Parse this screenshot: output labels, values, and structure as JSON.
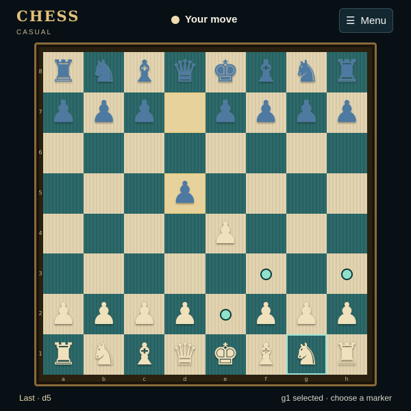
{
  "brand": {
    "title": "CHESS",
    "subtitle": "CASUAL"
  },
  "turn": {
    "text": "Your move"
  },
  "menu": {
    "label": "Menu"
  },
  "board": {
    "ranks": [
      "8",
      "7",
      "6",
      "5",
      "4",
      "3",
      "2",
      "1"
    ],
    "files": [
      "a",
      "b",
      "c",
      "d",
      "e",
      "f",
      "g",
      "h"
    ],
    "position": [
      [
        "br",
        "bn",
        "bb",
        "bq",
        "bk",
        "bb",
        "bn",
        "br"
      ],
      [
        "bp",
        "bp",
        "bp",
        "",
        "bp",
        "bp",
        "bp",
        "bp"
      ],
      [
        "",
        "",
        "",
        "",
        "",
        "",
        "",
        ""
      ],
      [
        "",
        "",
        "",
        "bp",
        "",
        "",
        "",
        ""
      ],
      [
        "",
        "",
        "",
        "",
        "wp",
        "",
        "",
        ""
      ],
      [
        "",
        "",
        "",
        "",
        "",
        "",
        "",
        ""
      ],
      [
        "wp",
        "wp",
        "wp",
        "wp",
        "",
        "wp",
        "wp",
        "wp"
      ],
      [
        "wr",
        "wn",
        "wb",
        "wq",
        "wk",
        "wb",
        "wn",
        "wr"
      ]
    ],
    "last_move_squares": [
      "d7",
      "d5"
    ],
    "selected_square": "g1",
    "move_markers": [
      "f3",
      "h3",
      "e2"
    ],
    "colors": {
      "light": "#e2d4b2",
      "dark": "#2d6a6c",
      "black_piece": "#4e79a0",
      "white_piece": "#efe1bc",
      "marker": "#8fe0cd"
    }
  },
  "status": {
    "last": "Last · d5",
    "hint": "g1 selected · choose a marker"
  }
}
